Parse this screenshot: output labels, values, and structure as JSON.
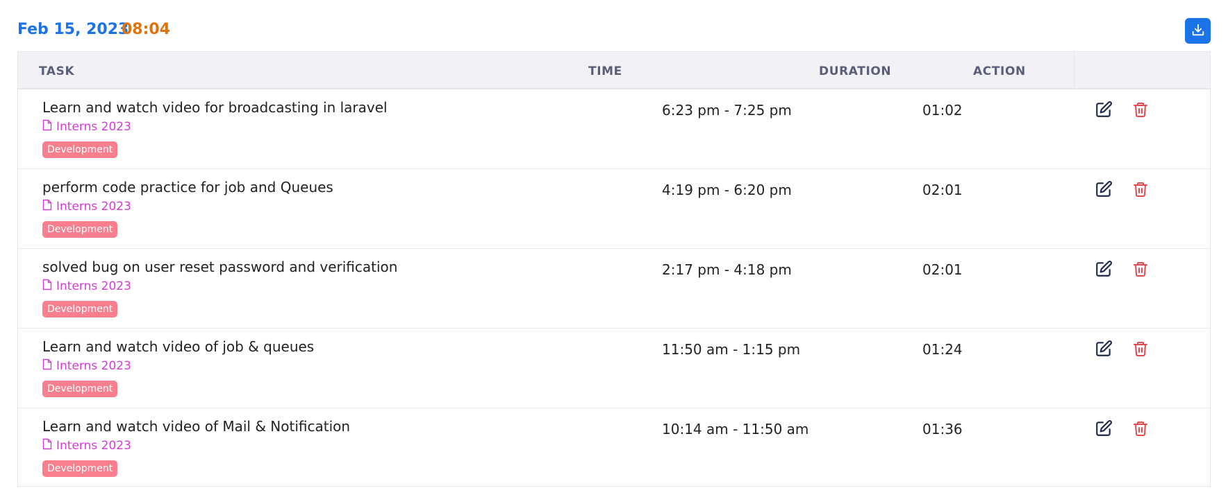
{
  "header": {
    "date": "Feb 15, 2023",
    "total_time": "08:04",
    "download_icon": "download-icon"
  },
  "table": {
    "columns": [
      "TASK",
      "TIME",
      "DURATION",
      "ACTION"
    ],
    "rows": [
      {
        "title": "Learn and watch video for broadcasting in laravel",
        "project": "Interns 2023",
        "tag": "Development",
        "time": "6:23 pm - 7:25 pm",
        "duration": "01:02"
      },
      {
        "title": "perform code practice for job and Queues",
        "project": "Interns 2023",
        "tag": "Development",
        "time": "4:19 pm - 6:20 pm",
        "duration": "02:01"
      },
      {
        "title": "solved bug on user reset password and verification",
        "project": "Interns 2023",
        "tag": "Development",
        "time": "2:17 pm - 4:18 pm",
        "duration": "02:01"
      },
      {
        "title": "Learn and watch video of job & queues",
        "project": "Interns 2023",
        "tag": "Development",
        "time": "11:50 am - 1:15 pm",
        "duration": "01:24"
      },
      {
        "title": "Learn and watch video of Mail & Notification",
        "project": "Interns 2023",
        "tag": "Development",
        "time": "10:14 am - 11:50 am",
        "duration": "01:36"
      }
    ]
  },
  "colors": {
    "date": "#1a73e8",
    "total": "#e0730d",
    "project": "#d63ad6",
    "tag_bg": "#f97f8f",
    "edit_icon": "#1e2a4a",
    "delete_icon": "#e5484d",
    "download_bg": "#1a73e8"
  }
}
